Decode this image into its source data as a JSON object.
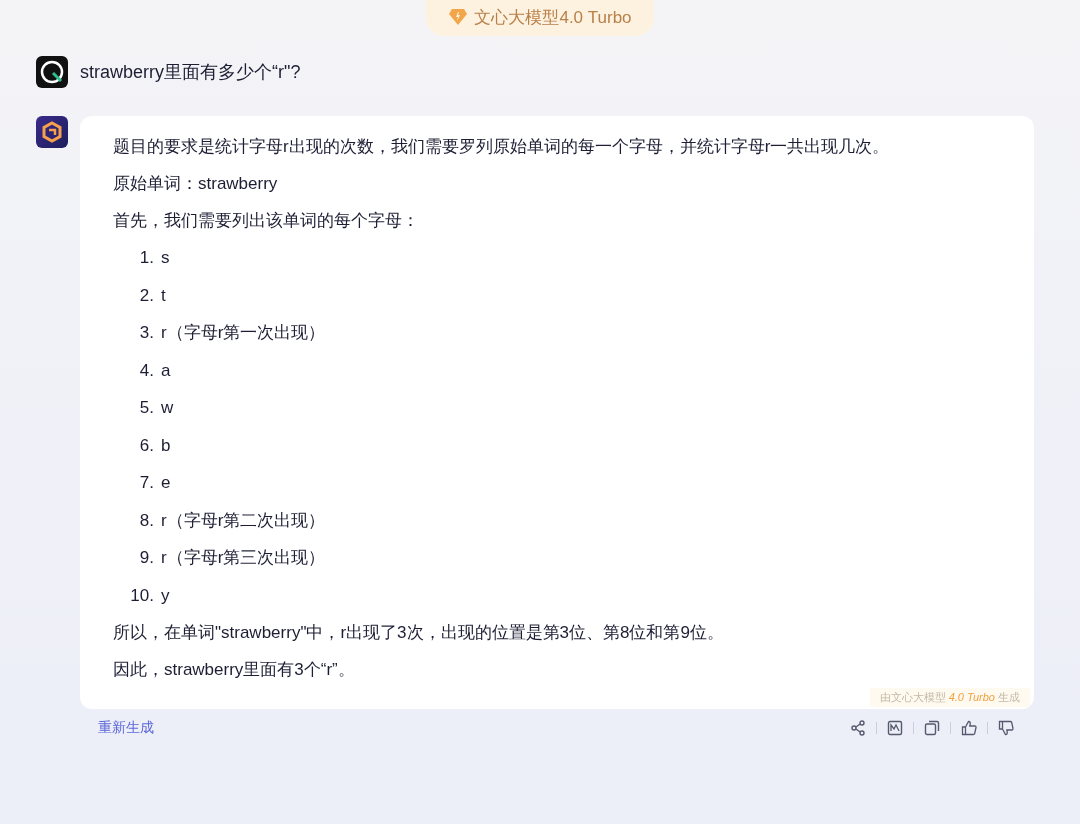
{
  "model_badge": {
    "label": "文心大模型4.0 Turbo"
  },
  "user_message": {
    "text": "strawberry里面有多少个“r\"?"
  },
  "answer": {
    "intro": [
      "题目的要求是统计字母r出现的次数，我们需要罗列原始单词的每一个字母，并统计字母r一共出现几次。",
      "原始单词：strawberry",
      "首先，我们需要列出该单词的每个字母："
    ],
    "list": [
      {
        "number": "1.",
        "text": "s"
      },
      {
        "number": "2.",
        "text": "t"
      },
      {
        "number": "3.",
        "text": "r（字母r第一次出现）"
      },
      {
        "number": "4.",
        "text": "a"
      },
      {
        "number": "5.",
        "text": "w"
      },
      {
        "number": "6.",
        "text": "b"
      },
      {
        "number": "7.",
        "text": "e"
      },
      {
        "number": "8.",
        "text": "r（字母r第二次出现）"
      },
      {
        "number": "9.",
        "text": "r（字母r第三次出现）"
      },
      {
        "number": "10.",
        "text": "y"
      }
    ],
    "outro": [
      "所以，在单词\"strawberry\"中，r出现了3次，出现的位置是第3位、第8位和第9位。",
      "因此，strawberry里面有3个“r”。"
    ],
    "generated_note": {
      "prefix": "由文心大模型",
      "highlight": "4.0 Turbo",
      "suffix": "生成"
    }
  },
  "regenerate_link": "重新生成"
}
